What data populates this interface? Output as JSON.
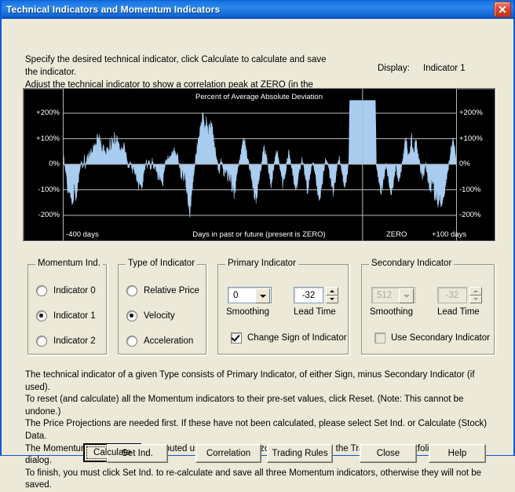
{
  "window": {
    "title": "Technical Indicators and Momentum Indicators",
    "close_icon": "close-icon",
    "titlebar_color": "#1874e0"
  },
  "intro": {
    "line1": "Specify the desired technical indicator, click Calculate to calculate and save the indicator.",
    "line2": "Adjust the technical indicator to show a correlation peak at ZERO (in the Correlation Test).",
    "display_label": "Display:",
    "display_value": "Indicator 1"
  },
  "chart_data": {
    "type": "area",
    "title": "Percent of Average Absolute Deviation",
    "xlabel": "Days in past or future (present is ZERO)",
    "ylabel": "",
    "ylim": [
      -200,
      200
    ],
    "xlim": [
      -400,
      100
    ],
    "y_ticks": [
      "+200%",
      "+100%",
      "0%",
      "-100%",
      "-200%"
    ],
    "y_tick_values": [
      200,
      100,
      0,
      -100,
      -200
    ],
    "x_tick_labels": [
      "-400 days",
      "ZERO",
      "+100 days"
    ],
    "x_tick_values": [
      -400,
      0,
      100
    ],
    "grid": true,
    "legend": "none",
    "series_color": "#a8cdf0",
    "background": "#000000",
    "axis_color": "#b8b8b8",
    "zero_marker": 0,
    "values": [
      -10,
      18,
      -5,
      -30,
      -62,
      -88,
      -112,
      -78,
      -120,
      -148,
      -132,
      -118,
      -95,
      -140,
      -126,
      -96,
      -60,
      -28,
      -8,
      12,
      -18,
      6,
      26,
      -12,
      10,
      34,
      18,
      46,
      30,
      58,
      42,
      70,
      54,
      86,
      62,
      96,
      78,
      104,
      86,
      70,
      58,
      72,
      46,
      58,
      34,
      52,
      68,
      46,
      80,
      60,
      92,
      74,
      100,
      82,
      96,
      78,
      104,
      86,
      70,
      54,
      66,
      48,
      80,
      58,
      38,
      20,
      2,
      -14,
      -4,
      12,
      -8,
      -26,
      -12,
      -40,
      -22,
      -62,
      -48,
      -84,
      -68,
      -110,
      -90,
      -70,
      -44,
      -20,
      -4,
      8,
      -6,
      16,
      2,
      -18,
      -6,
      14,
      -4,
      -24,
      -10,
      -38,
      -20,
      -56,
      -34,
      -72,
      -50,
      -88,
      -62,
      -30,
      -8,
      18,
      4,
      28,
      12,
      36,
      20,
      44,
      26,
      52,
      34,
      48,
      30,
      26,
      10,
      -10,
      -32,
      -58,
      -26,
      -48,
      -14,
      -68,
      -100,
      -130,
      -170,
      -210,
      -166,
      -120,
      -76,
      -40,
      -10,
      20,
      46,
      70,
      96,
      118,
      142,
      160,
      178,
      168,
      150,
      132,
      156,
      140,
      122,
      148,
      168,
      150,
      126,
      100,
      74,
      52,
      28,
      8,
      -12,
      -30,
      -8,
      16,
      4,
      -18,
      -40,
      -22,
      -46,
      -28,
      -60,
      -38,
      -72,
      -50,
      -94,
      -70,
      -116,
      -96,
      -76,
      -50,
      -26,
      -6,
      14,
      34,
      58,
      80,
      104,
      86,
      62,
      40,
      22,
      6,
      -12,
      -30,
      -50,
      -72,
      -94,
      -118,
      -142,
      -120,
      -96,
      -70,
      -46,
      -24,
      -6,
      16,
      40,
      62,
      44,
      26,
      8,
      -14,
      -36,
      -56,
      -76,
      -50,
      -28,
      -8,
      12,
      32,
      52,
      30,
      8,
      -14,
      -38,
      -60,
      -84,
      -62,
      -40,
      -18,
      4,
      26,
      48,
      26,
      4,
      -18,
      -42,
      -64,
      -88,
      -112,
      -90,
      -66,
      -42,
      -20,
      0,
      18,
      8,
      -12,
      -34,
      -56,
      -78,
      -100,
      -78,
      -54,
      -30,
      -8,
      10,
      0,
      -20,
      -42,
      -64,
      -86,
      -110,
      -134,
      -110,
      -86,
      -62,
      -38,
      -14,
      8,
      20,
      8,
      -8,
      -28,
      -48,
      -68,
      -88,
      -110,
      -88,
      -64,
      -40,
      -16,
      6,
      26,
      12,
      -6,
      -26,
      -46,
      -66,
      -86,
      -66,
      -44,
      -22,
      0,
      250,
      250,
      250,
      250,
      250,
      250,
      250,
      250,
      250,
      250,
      250,
      250,
      250,
      250,
      250,
      250,
      250,
      250,
      250,
      250,
      250,
      250,
      250,
      250,
      250,
      250,
      250,
      0,
      -24,
      -48,
      -72,
      -96,
      -120,
      -98,
      -74,
      -50,
      -26,
      -2,
      -26,
      -50,
      -74,
      -98,
      -122,
      -100,
      -76,
      -52,
      -28,
      -4,
      -28,
      -52,
      -76,
      -52,
      -28,
      -4,
      20,
      44,
      68,
      92,
      70,
      48,
      26,
      48,
      70,
      92,
      70,
      48,
      70,
      92,
      70,
      48,
      26,
      4,
      -18,
      -40,
      -62,
      -40,
      -18,
      4,
      -18,
      -40,
      -62,
      -84,
      -106,
      -84,
      -62,
      -84,
      -106,
      -128,
      -106,
      -128,
      -150,
      -128,
      -150,
      -172,
      -150,
      -128,
      -106,
      -84,
      -62,
      -40,
      -18,
      4,
      26,
      50,
      74,
      98,
      70,
      40,
      10,
      -10
    ]
  },
  "momentum_group": {
    "title": "Momentum Ind.",
    "options": [
      {
        "label": "Indicator 0",
        "selected": false
      },
      {
        "label": "Indicator 1",
        "selected": true
      },
      {
        "label": "Indicator 2",
        "selected": false
      }
    ]
  },
  "type_group": {
    "title": "Type of Indicator",
    "options": [
      {
        "label": "Relative Price",
        "selected": false
      },
      {
        "label": "Velocity",
        "selected": true
      },
      {
        "label": "Acceleration",
        "selected": false
      }
    ]
  },
  "primary_group": {
    "title": "Primary Indicator",
    "smoothing_value": "0",
    "smoothing_caption": "Smoothing",
    "lead_time_value": "-32",
    "lead_time_caption": "Lead Time",
    "change_sign_label": "Change Sign of Indicator",
    "change_sign_checked": true
  },
  "secondary_group": {
    "title": "Secondary Indicator",
    "smoothing_value": "512",
    "smoothing_caption": "Smoothing",
    "lead_time_value": "-32",
    "lead_time_caption": "Lead Time",
    "use_secondary_label": "Use Secondary Indicator",
    "use_secondary_checked": false,
    "disabled": true
  },
  "footnote": {
    "line1": "The technical indicator of a given Type consists of Primary Indicator, of either Sign, minus Secondary Indicator (if used).",
    "line2": "To reset (and calculate) all the Momentum indicators to their pre-set values, click Reset.  (Note: This cannot be undone.)",
    "line3": "The Price Projections are needed first. If these have not been calculated, please select Set Ind. or Calculate (Stock) Data.",
    "line4": "The Momentum indicators are computed using a Time Horizon which is set in the Trading and Portfolio Parameters dialog.",
    "line5": "To finish, you must click Set Ind. to re-calculate and save all three Momentum indicators, otherwise they will not be saved."
  },
  "buttons": {
    "calculate": "Calculate",
    "set_ind": "Set Ind.",
    "correlation": "Correlation",
    "trading_rules": "Trading Rules",
    "close": "Close",
    "help": "Help"
  }
}
